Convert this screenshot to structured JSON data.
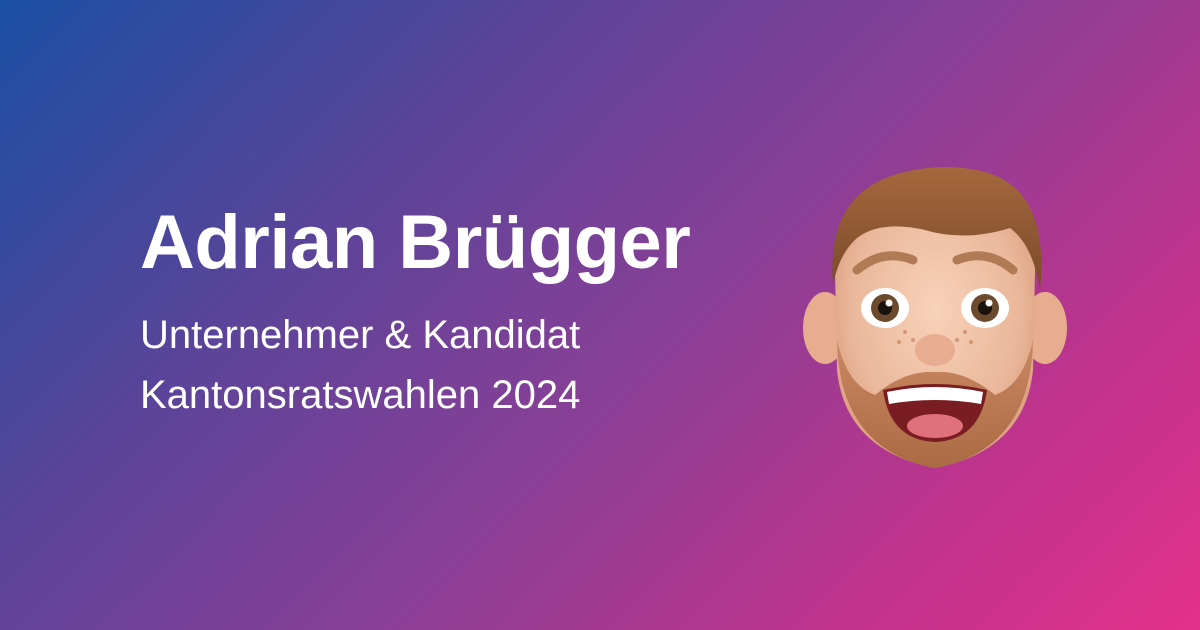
{
  "card": {
    "name": "Adrian Brügger",
    "line1": "Unternehmer & Kandidat",
    "line2": "Kantonsratswahlen 2024"
  },
  "avatar": {
    "icon": "memoji-avatar-icon"
  },
  "colors": {
    "gradient_start": "#1a4fa3",
    "gradient_mid": "#8a3f96",
    "gradient_end": "#e3318a",
    "text": "#ffffff"
  }
}
